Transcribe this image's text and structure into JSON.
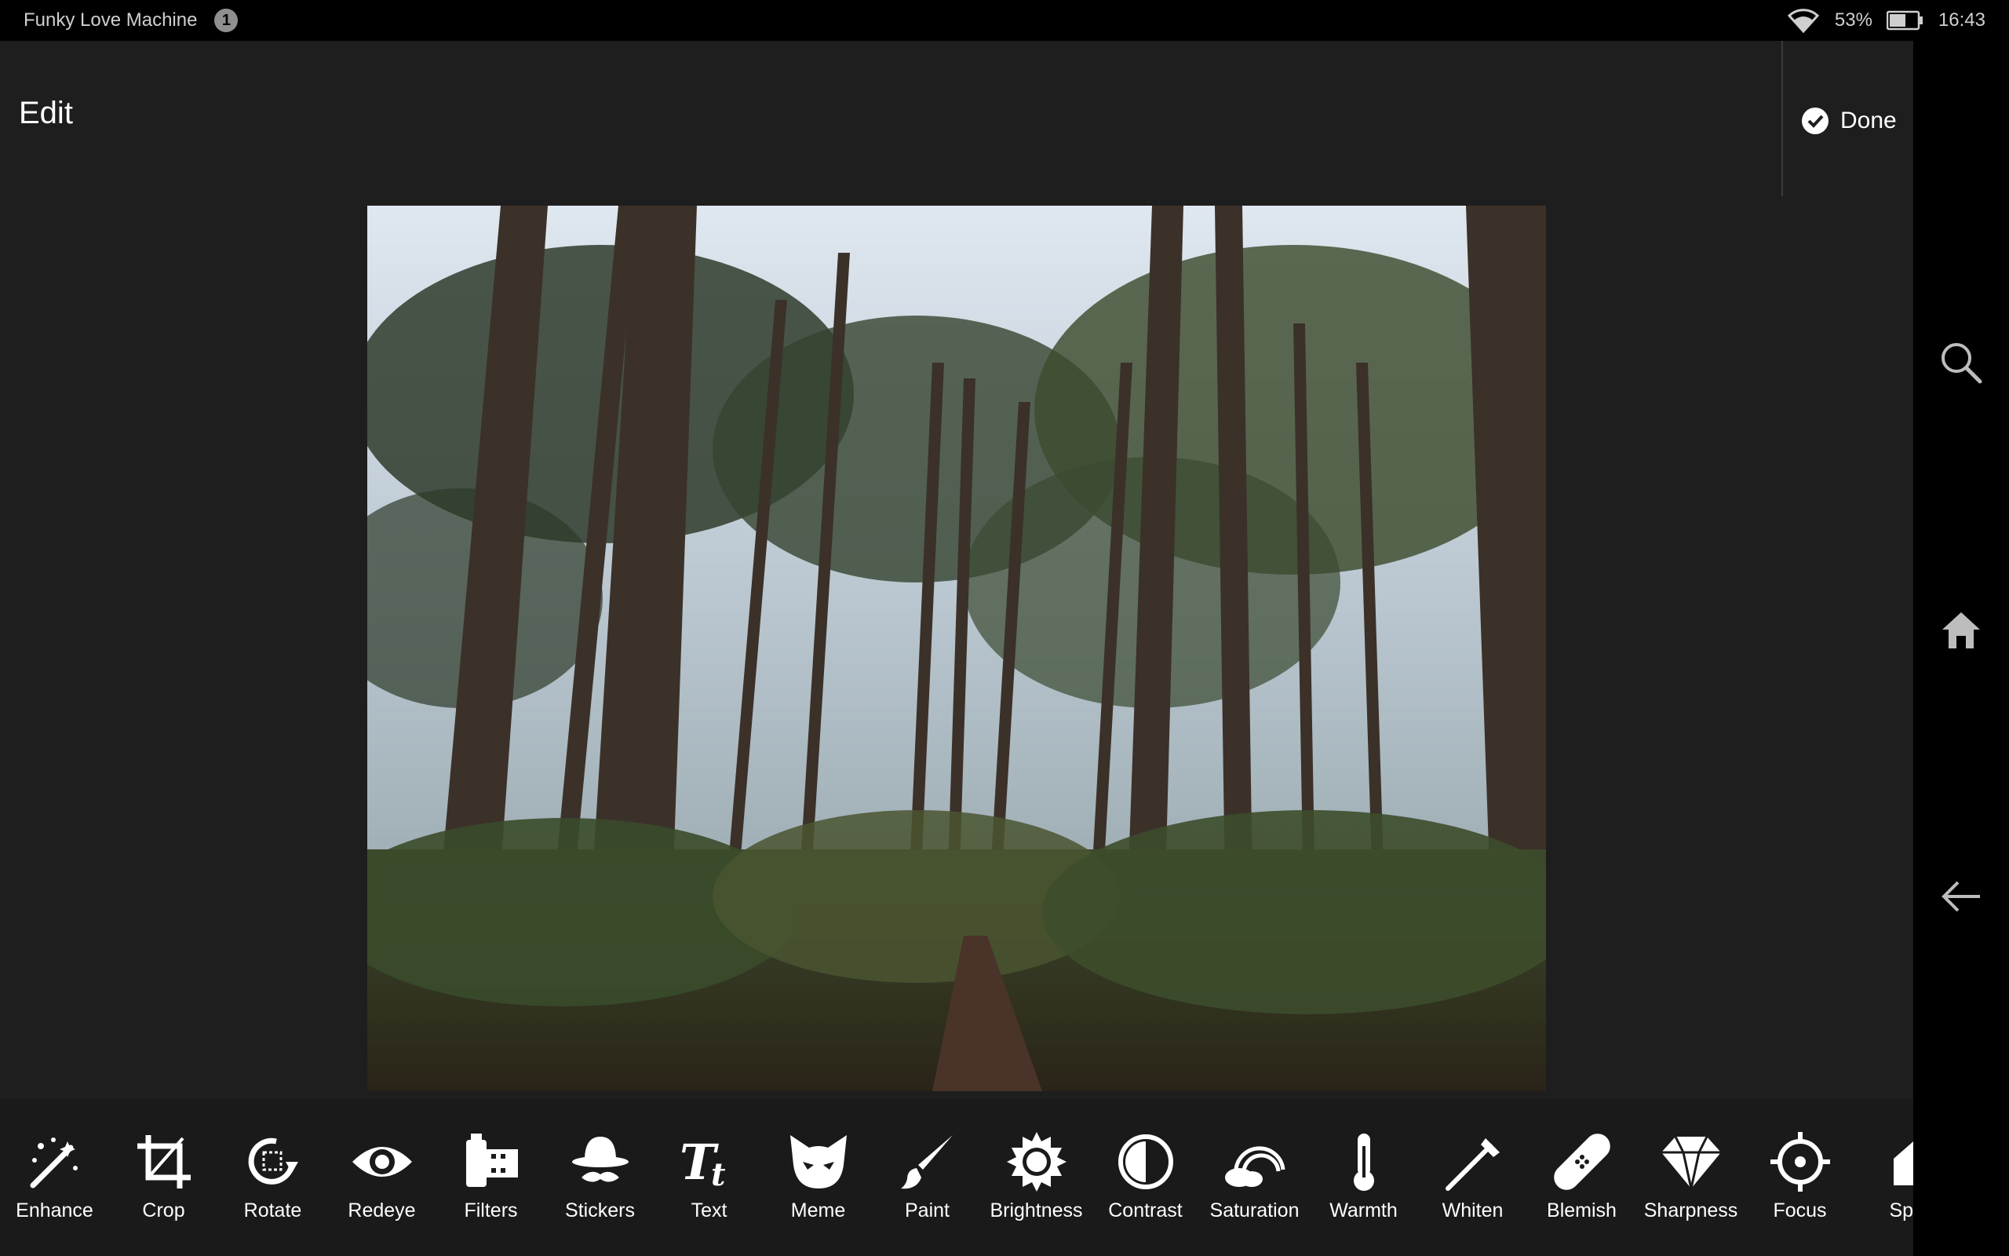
{
  "status_bar": {
    "app_name": "Funky Love Machine",
    "notification_count": "1",
    "battery": "53%",
    "time": "16:43"
  },
  "header": {
    "title": "Edit",
    "done_label": "Done"
  },
  "toolbar": {
    "tools": [
      {
        "label": "Enhance",
        "icon": "magic-wand-icon"
      },
      {
        "label": "Crop",
        "icon": "crop-icon"
      },
      {
        "label": "Rotate",
        "icon": "rotate-icon"
      },
      {
        "label": "Redeye",
        "icon": "eye-icon"
      },
      {
        "label": "Filters",
        "icon": "film-icon"
      },
      {
        "label": "Stickers",
        "icon": "hat-mustache-icon"
      },
      {
        "label": "Text",
        "icon": "text-icon"
      },
      {
        "label": "Meme",
        "icon": "cat-icon"
      },
      {
        "label": "Paint",
        "icon": "brush-icon"
      },
      {
        "label": "Brightness",
        "icon": "sun-icon"
      },
      {
        "label": "Contrast",
        "icon": "contrast-icon"
      },
      {
        "label": "Saturation",
        "icon": "rainbow-icon"
      },
      {
        "label": "Warmth",
        "icon": "thermometer-icon"
      },
      {
        "label": "Whiten",
        "icon": "toothbrush-icon"
      },
      {
        "label": "Blemish",
        "icon": "bandage-icon"
      },
      {
        "label": "Sharpness",
        "icon": "diamond-icon"
      },
      {
        "label": "Focus",
        "icon": "focus-icon"
      },
      {
        "label": "Spla",
        "icon": "splash-icon"
      }
    ]
  },
  "nav": {
    "search": "search-icon",
    "home": "home-icon",
    "back": "back-arrow-icon"
  },
  "colors": {
    "background": "#1e1e1e",
    "status_bar": "#000000",
    "toolbar": "#1a1a1a",
    "icon": "#ffffff"
  }
}
